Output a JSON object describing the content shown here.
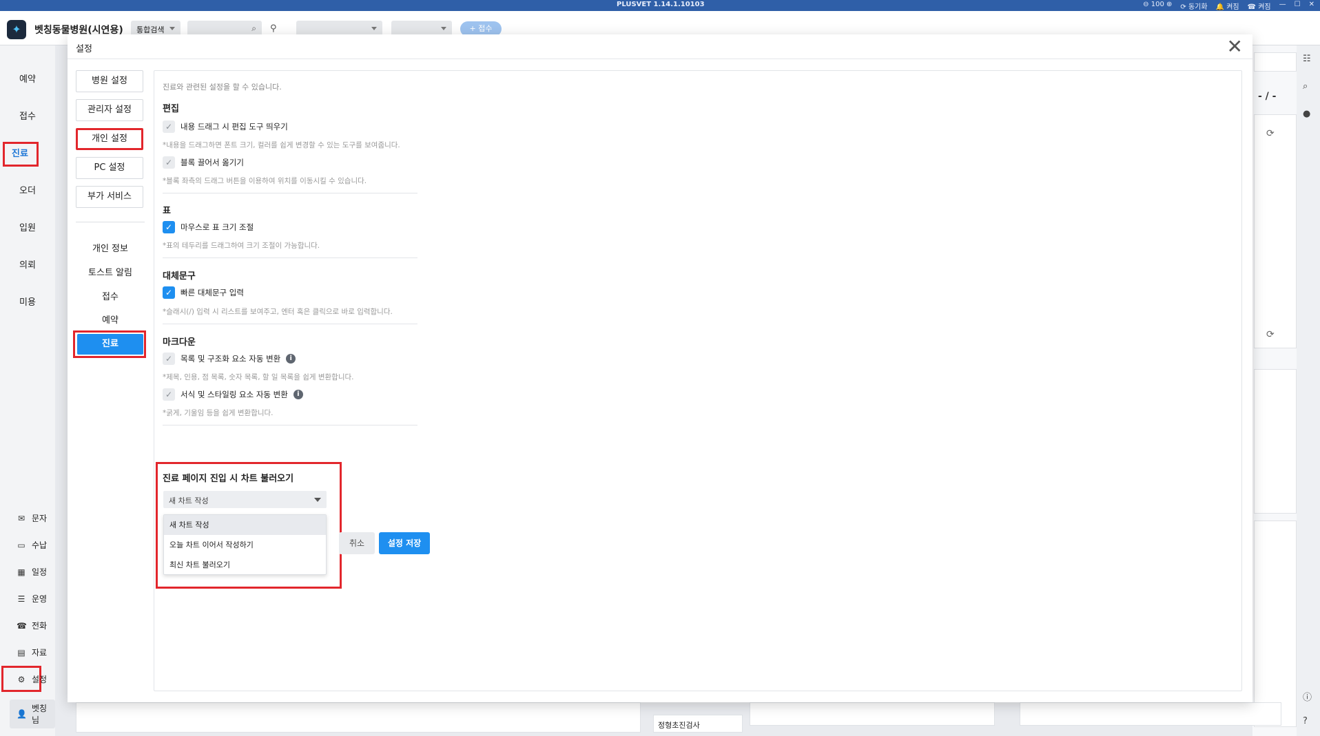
{
  "titlebar": {
    "version": "PLUSVET 1.14.1.10103",
    "zoom": "100",
    "sync": "동기화",
    "status1": "켜짐",
    "status2": "켜짐"
  },
  "appbar": {
    "hospital_name": "벳칭동물병원(시연용)",
    "search_scope": "통합검색",
    "receive_button": "+ 접수"
  },
  "sidebar": {
    "nav": [
      "예약",
      "접수",
      "진료",
      "오더",
      "입원",
      "의뢰",
      "미용"
    ],
    "active": "진료",
    "bottom": [
      {
        "label": "문자",
        "icon": "mail-icon"
      },
      {
        "label": "수납",
        "icon": "card-icon"
      },
      {
        "label": "일정",
        "icon": "calendar-icon"
      },
      {
        "label": "운영",
        "icon": "list-icon"
      },
      {
        "label": "전화",
        "icon": "phone-icon"
      },
      {
        "label": "자료",
        "icon": "document-icon"
      },
      {
        "label": "설정",
        "icon": "gear-icon"
      },
      {
        "label": "벳칭님",
        "icon": "user-icon"
      }
    ]
  },
  "background": {
    "right_text": "- / -",
    "bottom_item1": "정형초진검사"
  },
  "modal": {
    "title": "설정",
    "nav_buttons": [
      "병원 설정",
      "관리자 설정",
      "개인 설정",
      "PC 설정",
      "부가 서비스"
    ],
    "sub_items": [
      "개인 정보",
      "토스트 알림",
      "접수",
      "예약",
      "진료"
    ],
    "active_sub": "진료",
    "description": "진료와 관련된 설정을 할 수 있습니다.",
    "sections": {
      "edit": {
        "title": "편집",
        "item1": "내용 드래그 시 편집 도구 띄우기",
        "hint1": "*내용을 드래그하면 폰트 크기, 컬러를 쉽게 변경할 수 있는 도구를 보여줍니다.",
        "item2": "블록 끌어서 옮기기",
        "hint2": "*블록 좌측의 드래그 버튼을 이용하여 위치를 이동시킬 수 있습니다."
      },
      "table": {
        "title": "표",
        "item1": "마우스로 표 크기 조절",
        "hint1": "*표의 테두리를 드래그하여 크기 조절이 가능합니다."
      },
      "alt_text": {
        "title": "대체문구",
        "item1": "빠른 대체문구 입력",
        "hint1": "*슬래시(/) 입력 시 리스트를 보여주고, 엔터 혹은 클릭으로 바로 입력합니다."
      },
      "markdown": {
        "title": "마크다운",
        "item1": "목록 및 구조화 요소 자동 변환",
        "hint1": "*제목, 인용, 점 목록, 숫자 목록, 할 일 목록을 쉽게 변환합니다.",
        "item2": "서식 및 스타일링 요소 자동 변환",
        "hint2": "*굵게, 기울임 등을 쉽게 변환합니다."
      },
      "chart_load": {
        "title": "진료 페이지 진입 시 차트 불러오기",
        "selected": "새 차트 작성",
        "options": [
          "새 차트 작성",
          "오늘 차트 이어서 작성하기",
          "최신 차트 불러오기"
        ]
      }
    },
    "cancel_label": "취소",
    "save_label": "설정 저장"
  }
}
